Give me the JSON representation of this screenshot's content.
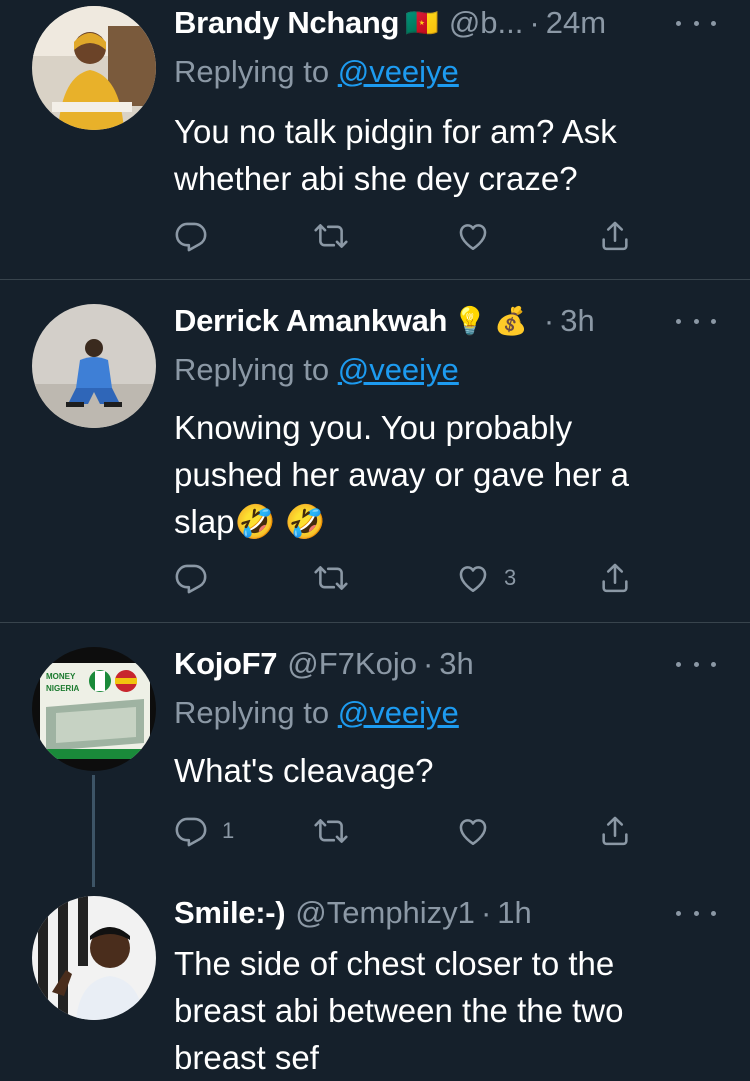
{
  "tweets": [
    {
      "name": "Brandy Nchang",
      "emoji": "🇨🇲",
      "handle": "@b...",
      "time": "24m",
      "replying_label": "Replying to",
      "replying_to": "@veeiye",
      "text": "You no talk pidgin for am? Ask whether abi she dey craze?",
      "replies": "",
      "retweets": "",
      "likes": ""
    },
    {
      "name": "Derrick Amankwah",
      "emoji": "💡 💰",
      "handle": "",
      "time": "3h",
      "replying_label": "Replying to",
      "replying_to": "@veeiye",
      "text": "Knowing you. You probably pushed her away or gave her a slap🤣 🤣",
      "replies": "",
      "retweets": "",
      "likes": "3"
    },
    {
      "name": "KojoF7",
      "emoji": "",
      "handle": "@F7Kojo",
      "time": "3h",
      "replying_label": "Replying to",
      "replying_to": "@veeiye",
      "text": "What's cleavage?",
      "replies": "1",
      "retweets": "",
      "likes": ""
    },
    {
      "name": "Smile:-)",
      "emoji": "",
      "handle": "@Temphizy1",
      "time": "1h",
      "text": "The side of chest closer to the breast abi between the the two breast sef"
    }
  ],
  "avatar_text": {
    "kojo_line1": "MONEY",
    "kojo_line2": "NIGERIA"
  },
  "colors": {
    "background": "#15202b",
    "secondary_text": "#8b98a5",
    "link": "#1d9bf0",
    "divider": "#38444d"
  },
  "icons": [
    "reply-icon",
    "retweet-icon",
    "like-icon",
    "share-icon",
    "more-icon"
  ]
}
